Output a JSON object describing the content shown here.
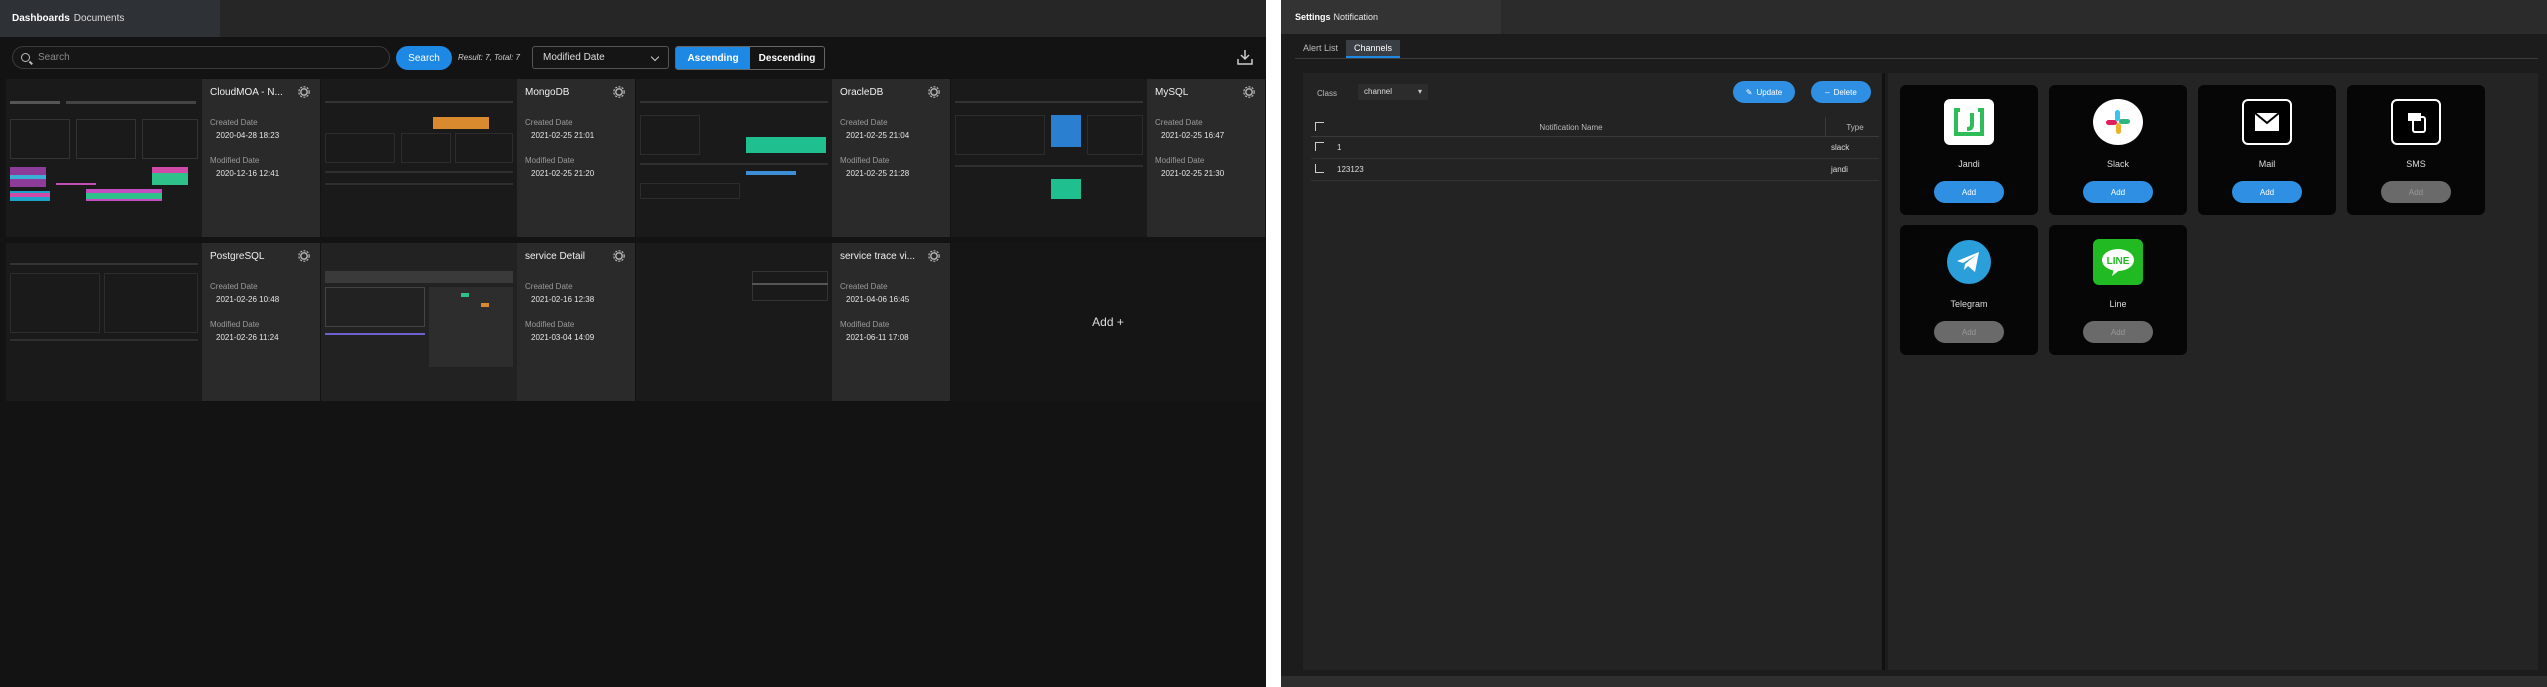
{
  "left": {
    "header": {
      "title_bold": "Dashboards",
      "title_rest": "Documents"
    },
    "toolbar": {
      "search_placeholder": "Search",
      "search_button": "Search",
      "result_text": "Result: 7, Total: 7",
      "sort_value": "Modified Date",
      "ascending": "Ascending",
      "descending": "Descending",
      "active_order": "Ascending"
    },
    "cards": [
      {
        "name": "CloudMOA - N...",
        "created_label": "Created Date",
        "created": "2020-04-28 18:23",
        "modified_label": "Modified Date",
        "modified": "2020-12-16 12:41"
      },
      {
        "name": "MongoDB",
        "created_label": "Created Date",
        "created": "2021-02-25 21:01",
        "modified_label": "Modified Date",
        "modified": "2021-02-25 21:20"
      },
      {
        "name": "OracleDB",
        "created_label": "Created Date",
        "created": "2021-02-25 21:04",
        "modified_label": "Modified Date",
        "modified": "2021-02-25 21:28"
      },
      {
        "name": "MySQL",
        "created_label": "Created Date",
        "created": "2021-02-25 16:47",
        "modified_label": "Modified Date",
        "modified": "2021-02-25 21:30"
      },
      {
        "name": "PostgreSQL",
        "created_label": "Created Date",
        "created": "2021-02-26 10:48",
        "modified_label": "Modified Date",
        "modified": "2021-02-26 11:24"
      },
      {
        "name": "service Detail",
        "created_label": "Created Date",
        "created": "2021-02-16 12:38",
        "modified_label": "Modified Date",
        "modified": "2021-03-04 14:09"
      },
      {
        "name": "service trace vi...",
        "created_label": "Created Date",
        "created": "2021-04-06 16:45",
        "modified_label": "Modified Date",
        "modified": "2021-06-11 17:08"
      }
    ],
    "add_label": "Add +"
  },
  "right": {
    "header": {
      "title_bold": "Settings",
      "title_rest": "Notification"
    },
    "tabs": [
      "Alert List",
      "Channels"
    ],
    "active_tab": "Channels",
    "list": {
      "class_label": "Class",
      "class_value": "channel",
      "update_button": "Update",
      "delete_button": "Delete",
      "columns": [
        "Notification Name",
        "Type"
      ],
      "rows": [
        {
          "name": "1",
          "type": "slack"
        },
        {
          "name": "123123",
          "type": "jandi"
        }
      ]
    },
    "channels": [
      {
        "name": "Jandi",
        "button": "Add",
        "enabled": true,
        "icon": "jandi-icon",
        "color": "#2ebd59"
      },
      {
        "name": "Slack",
        "button": "Add",
        "enabled": true,
        "icon": "slack-icon",
        "color": "#e01e5a"
      },
      {
        "name": "Mail",
        "button": "Add",
        "enabled": true,
        "icon": "mail-icon",
        "color": "#000000"
      },
      {
        "name": "SMS",
        "button": "Add",
        "enabled": false,
        "icon": "sms-icon",
        "color": "#000000"
      },
      {
        "name": "Telegram",
        "button": "Add",
        "enabled": false,
        "icon": "telegram-icon",
        "color": "#2a9fd9"
      },
      {
        "name": "Line",
        "button": "Add",
        "enabled": false,
        "icon": "line-icon",
        "color": "#22ba22"
      }
    ]
  },
  "colors": {
    "accent": "#1e88e5",
    "panel_bg": "#131313",
    "card_info_bg": "#2a2a2a"
  }
}
